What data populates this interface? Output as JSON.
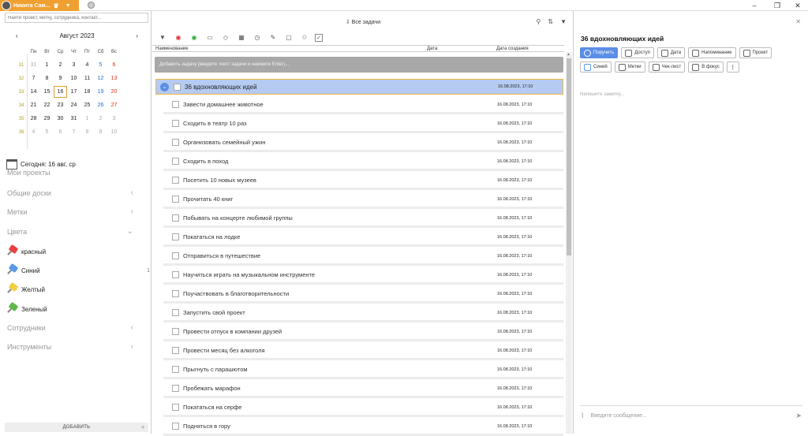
{
  "titlebar": {
    "user_name": "Никита Сам...",
    "controls": [
      "–",
      "❐",
      "✕"
    ]
  },
  "sidebar": {
    "search_placeholder": "Найти проект, метку, сотрудника, контакт...",
    "calendar": {
      "month_label": "Август 2023",
      "weekdays": [
        "Пн",
        "Вт",
        "Ср",
        "Чт",
        "Пт",
        "Сб",
        "Вс"
      ],
      "weeks": [
        {
          "num": "31",
          "days": [
            "31",
            "1",
            "2",
            "3",
            "4",
            "5",
            "6"
          ]
        },
        {
          "num": "32",
          "days": [
            "7",
            "8",
            "9",
            "10",
            "11",
            "12",
            "13"
          ]
        },
        {
          "num": "33",
          "days": [
            "14",
            "15",
            "16",
            "17",
            "18",
            "19",
            "20"
          ]
        },
        {
          "num": "34",
          "days": [
            "21",
            "22",
            "23",
            "24",
            "25",
            "26",
            "27"
          ]
        },
        {
          "num": "35",
          "days": [
            "28",
            "29",
            "30",
            "31",
            "1",
            "2",
            "3"
          ]
        },
        {
          "num": "36",
          "days": [
            "4",
            "5",
            "6",
            "7",
            "8",
            "9",
            "10"
          ]
        }
      ],
      "today_label": "Сегодня: 16 авг, ср"
    },
    "sections": {
      "my_projects": "Мои проекты",
      "shared_boards": "Общие доски",
      "tags": "Метки",
      "colors": "Цвета",
      "employees": "Сотрудники",
      "tools": "Инструменты"
    },
    "colors": [
      {
        "label": "красный",
        "color": "#e84040",
        "count": ""
      },
      {
        "label": "Синий",
        "color": "#5b9be6",
        "count": "1"
      },
      {
        "label": "Желтый",
        "color": "#f0d040",
        "count": ""
      },
      {
        "label": "Зеленый",
        "color": "#60b848",
        "count": ""
      }
    ],
    "add_label": "ДОБАВИТЬ",
    "add_plus": "+"
  },
  "main": {
    "title": "⇩ Все задачи",
    "columns": {
      "name": "Наименование",
      "date": "Дата",
      "created": "Дата создания"
    },
    "add_task_placeholder": "Добавить задачу (введите текст задачи и нажмите Enter)...",
    "parent_task": {
      "name": "36 вдохновляющих идей",
      "created": "16.08.2023, 17:10"
    },
    "tasks": [
      {
        "name": "Завести домашнее животное",
        "created": "16.08.2023, 17:10"
      },
      {
        "name": "Сходить в театр 10 раз",
        "created": "16.08.2023, 17:10"
      },
      {
        "name": "Организовать семейный ужин",
        "created": "16.08.2023, 17:10"
      },
      {
        "name": "Сходить в поход",
        "created": "16.08.2023, 17:10"
      },
      {
        "name": "Посетить 10 новых музеев",
        "created": "16.08.2023, 17:10"
      },
      {
        "name": "Прочитать 40 книг",
        "created": "16.08.2023, 17:10"
      },
      {
        "name": "Побывать на концерте любимой группы",
        "created": "16.08.2023, 17:10"
      },
      {
        "name": "Покататься на лодке",
        "created": "16.08.2023, 17:10"
      },
      {
        "name": "Отправиться в путешествие",
        "created": "16.08.2023, 17:10"
      },
      {
        "name": "Научиться играть на музыкальном инструменте",
        "created": "16.08.2023, 17:10"
      },
      {
        "name": "Поучаствовать в благотворительности",
        "created": "16.08.2023, 17:10"
      },
      {
        "name": "Запустить свой проект",
        "created": "16.08.2023, 17:10"
      },
      {
        "name": "Провести отпуск в компании друзей",
        "created": "16.08.2023, 17:10"
      },
      {
        "name": "Провести месяц без алкоголя",
        "created": "16.08.2023, 17:10"
      },
      {
        "name": "Прыгнуть с парашютом",
        "created": "16.08.2023, 17:10"
      },
      {
        "name": "Пробежать марафон",
        "created": "16.08.2023, 17:10"
      },
      {
        "name": "Покататься на серфе",
        "created": "16.08.2023, 17:10"
      },
      {
        "name": "Подняться в гору",
        "created": "16.08.2023, 17:10"
      }
    ]
  },
  "detail": {
    "title": "36 вдохновляющих идей",
    "buttons_row1": [
      "Поручить",
      "Доступ",
      "Дата",
      "Напоминание",
      "Проект"
    ],
    "buttons_row2": [
      "Синий",
      "Метки",
      "Чек-лист",
      "В фокус",
      "⋮"
    ],
    "note_placeholder": "Напишите заметку...",
    "message_placeholder": "Введите сообщение..."
  }
}
